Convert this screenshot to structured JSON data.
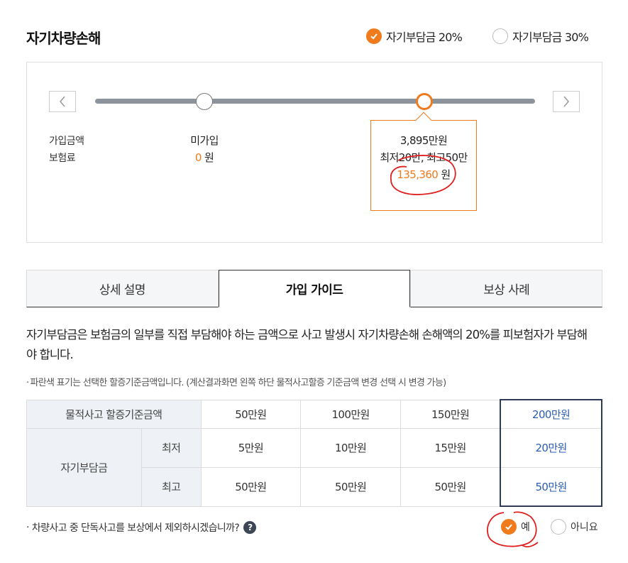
{
  "section_title": "자기차량손해",
  "deductible_options": [
    {
      "label": "자기부담금 20%",
      "selected": true
    },
    {
      "label": "자기부담금 30%",
      "selected": false
    }
  ],
  "slider": {
    "row_labels": [
      "가입금액",
      "보험료"
    ],
    "option_a": {
      "amount": "미가입",
      "premium": "0",
      "unit": "원"
    },
    "option_b": {
      "amount": "3,895만원",
      "range": "최저20만, 최고50만",
      "premium": "135,360",
      "unit": "원"
    }
  },
  "tabs": [
    {
      "label": "상세 설명",
      "active": false
    },
    {
      "label": "가입 가이드",
      "active": true
    },
    {
      "label": "보상 사례",
      "active": false
    }
  ],
  "description": "자기부담금은 보험금의 일부를 직접 부담해야 하는 금액으로 사고 발생시 자기차량손해 손해액의 20%를 피보험자가 부담해야 합니다.",
  "note": "파란색 표기는 선택한 할증기준금액입니다. (계산결과화면 왼쪽 하단 물적사고할증 기준금액 변경 선택 시 변경 가능)",
  "table": {
    "header_label": "물적사고 할증기준금액",
    "columns": [
      "50만원",
      "100만원",
      "150만원",
      "200만원"
    ],
    "row_group": "자기부담금",
    "rows": [
      {
        "label": "최저",
        "values": [
          "5만원",
          "10만원",
          "15만원",
          "20만원"
        ]
      },
      {
        "label": "최고",
        "values": [
          "50만원",
          "50만원",
          "50만원",
          "50만원"
        ]
      }
    ],
    "highlight_color": "#2a5db0"
  },
  "question": {
    "text": "차량사고 중 단독사고를 보상에서 제외하시겠습니까?",
    "help_symbol": "?",
    "options": [
      {
        "label": "예",
        "selected": true
      },
      {
        "label": "아니요",
        "selected": false
      }
    ]
  },
  "colors": {
    "accent": "#f07b1d",
    "annotation": "#e02020",
    "highlight_border": "#2f3a55"
  }
}
